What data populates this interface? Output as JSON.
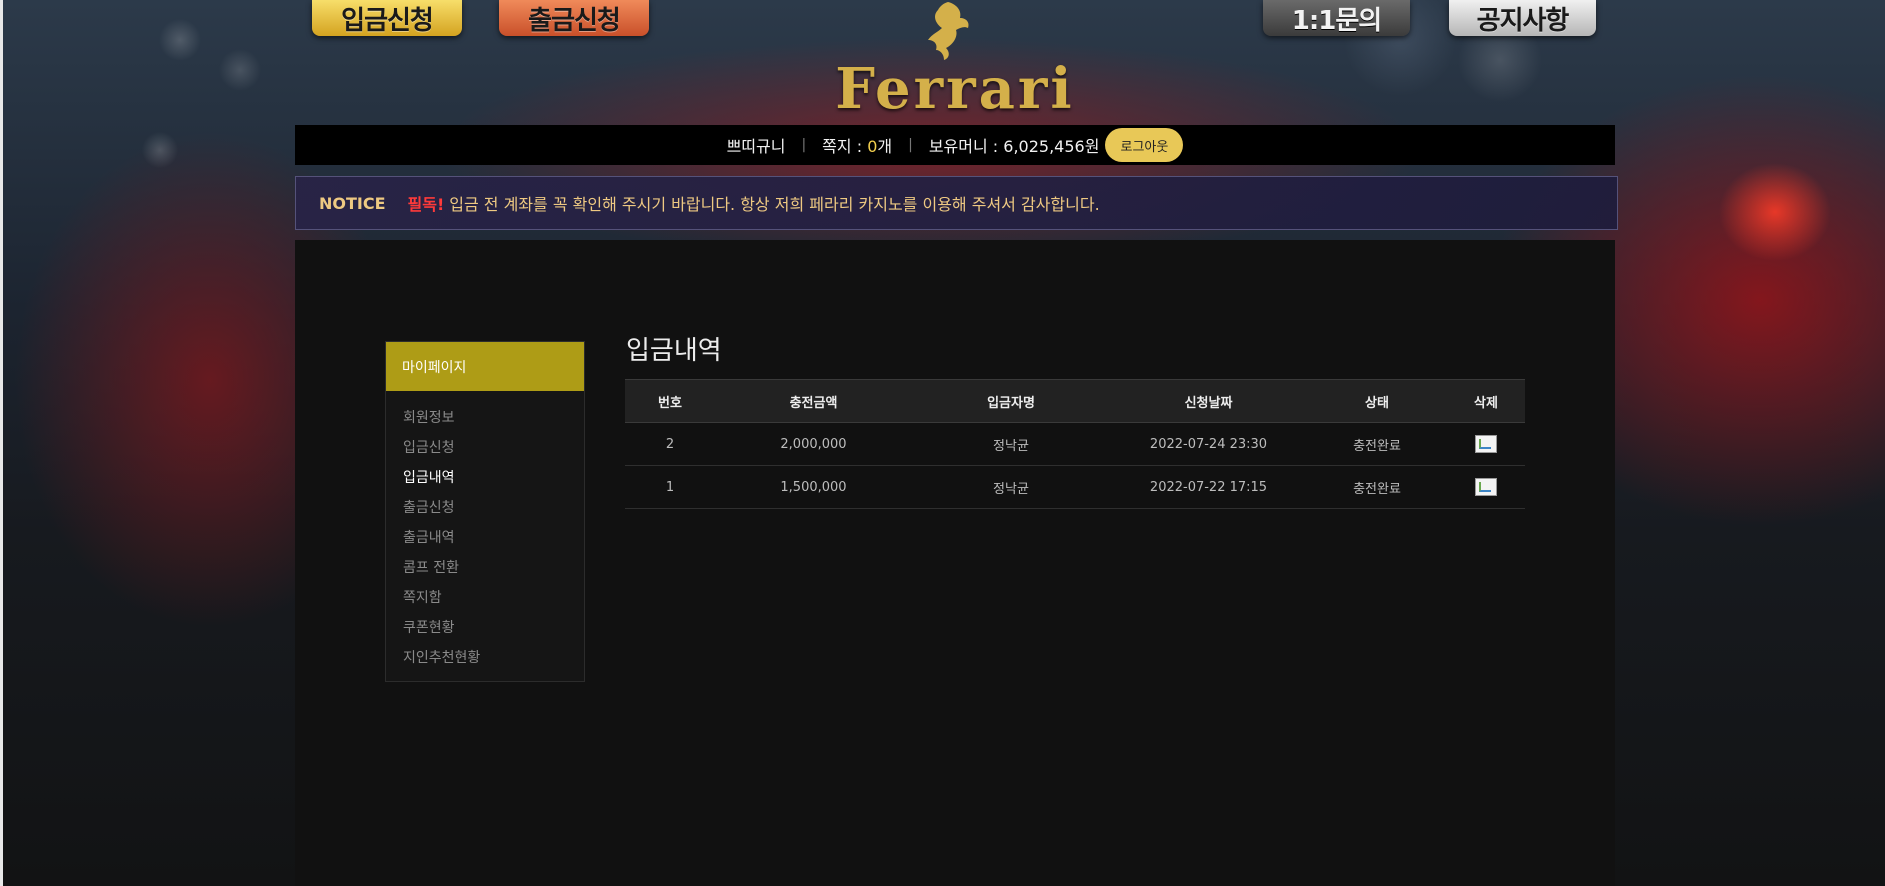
{
  "header": {
    "buttons": {
      "deposit": "입금신청",
      "withdraw": "출금신청",
      "inquiry": "1:1문의",
      "notice": "공지사항"
    },
    "logo_text": "Ferrari"
  },
  "userbar": {
    "username": "쁘띠규니",
    "separator": "|",
    "messages_label": "쪽지 : ",
    "messages_count": "0",
    "messages_unit": "개",
    "money_label": "보유머니 : 6,025,456원",
    "logout_label": "로그아웃"
  },
  "notice": {
    "label": "NOTICE",
    "strong": "필독!",
    "text": "입금 전 계좌를 꼭 확인해 주시기 바랍니다. 항상 저희 페라리 카지노를 이용해 주셔서 감사합니다."
  },
  "sidebar": {
    "title": "마이페이지",
    "items": [
      {
        "label": "회원정보"
      },
      {
        "label": "입금신청"
      },
      {
        "label": "입금내역"
      },
      {
        "label": "출금신청"
      },
      {
        "label": "출금내역"
      },
      {
        "label": "콤프 전환"
      },
      {
        "label": "쪽지함"
      },
      {
        "label": "쿠폰현황"
      },
      {
        "label": "지인추천현황"
      }
    ],
    "active_index": 2
  },
  "main": {
    "title": "입금내역",
    "columns": [
      "번호",
      "충전금액",
      "입금자명",
      "신청날짜",
      "상태",
      "삭제"
    ],
    "rows": [
      {
        "no": "2",
        "amount": "2,000,000",
        "depositor": "정낙균",
        "date": "2022-07-24 23:30",
        "status": "충전완료"
      },
      {
        "no": "1",
        "amount": "1,500,000",
        "depositor": "정낙균",
        "date": "2022-07-22 17:15",
        "status": "충전완료"
      }
    ]
  },
  "colors": {
    "gold_accent": "#ae9c16",
    "logout_bg": "#e8c857",
    "notice_red": "#ff3a3a",
    "notice_text": "#eec982"
  }
}
